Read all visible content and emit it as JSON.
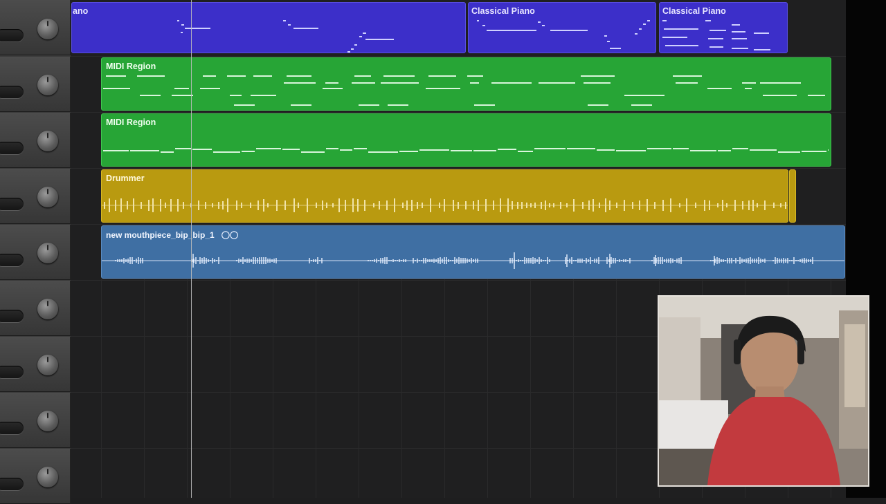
{
  "tracks": {
    "piano": {
      "regions": [
        {
          "name": "ano"
        },
        {
          "name": "Classical Piano"
        },
        {
          "name": "Classical Piano"
        }
      ]
    },
    "midi_1": {
      "region_name": "MIDI Region"
    },
    "midi_2": {
      "region_name": "MIDI Region"
    },
    "drummer": {
      "region_name": "Drummer"
    },
    "audio": {
      "region_name": "new mouthpiece_bip_bip_1",
      "loop_icon": "loop-icon"
    }
  },
  "colors": {
    "piano_region": "#3c2fc9",
    "midi_region": "#27a536",
    "drummer_region": "#b99a10",
    "audio_region": "#3f6fa3",
    "background": "#1e1e1f"
  },
  "webcam": {
    "description_icon": "webcam-overlay"
  }
}
